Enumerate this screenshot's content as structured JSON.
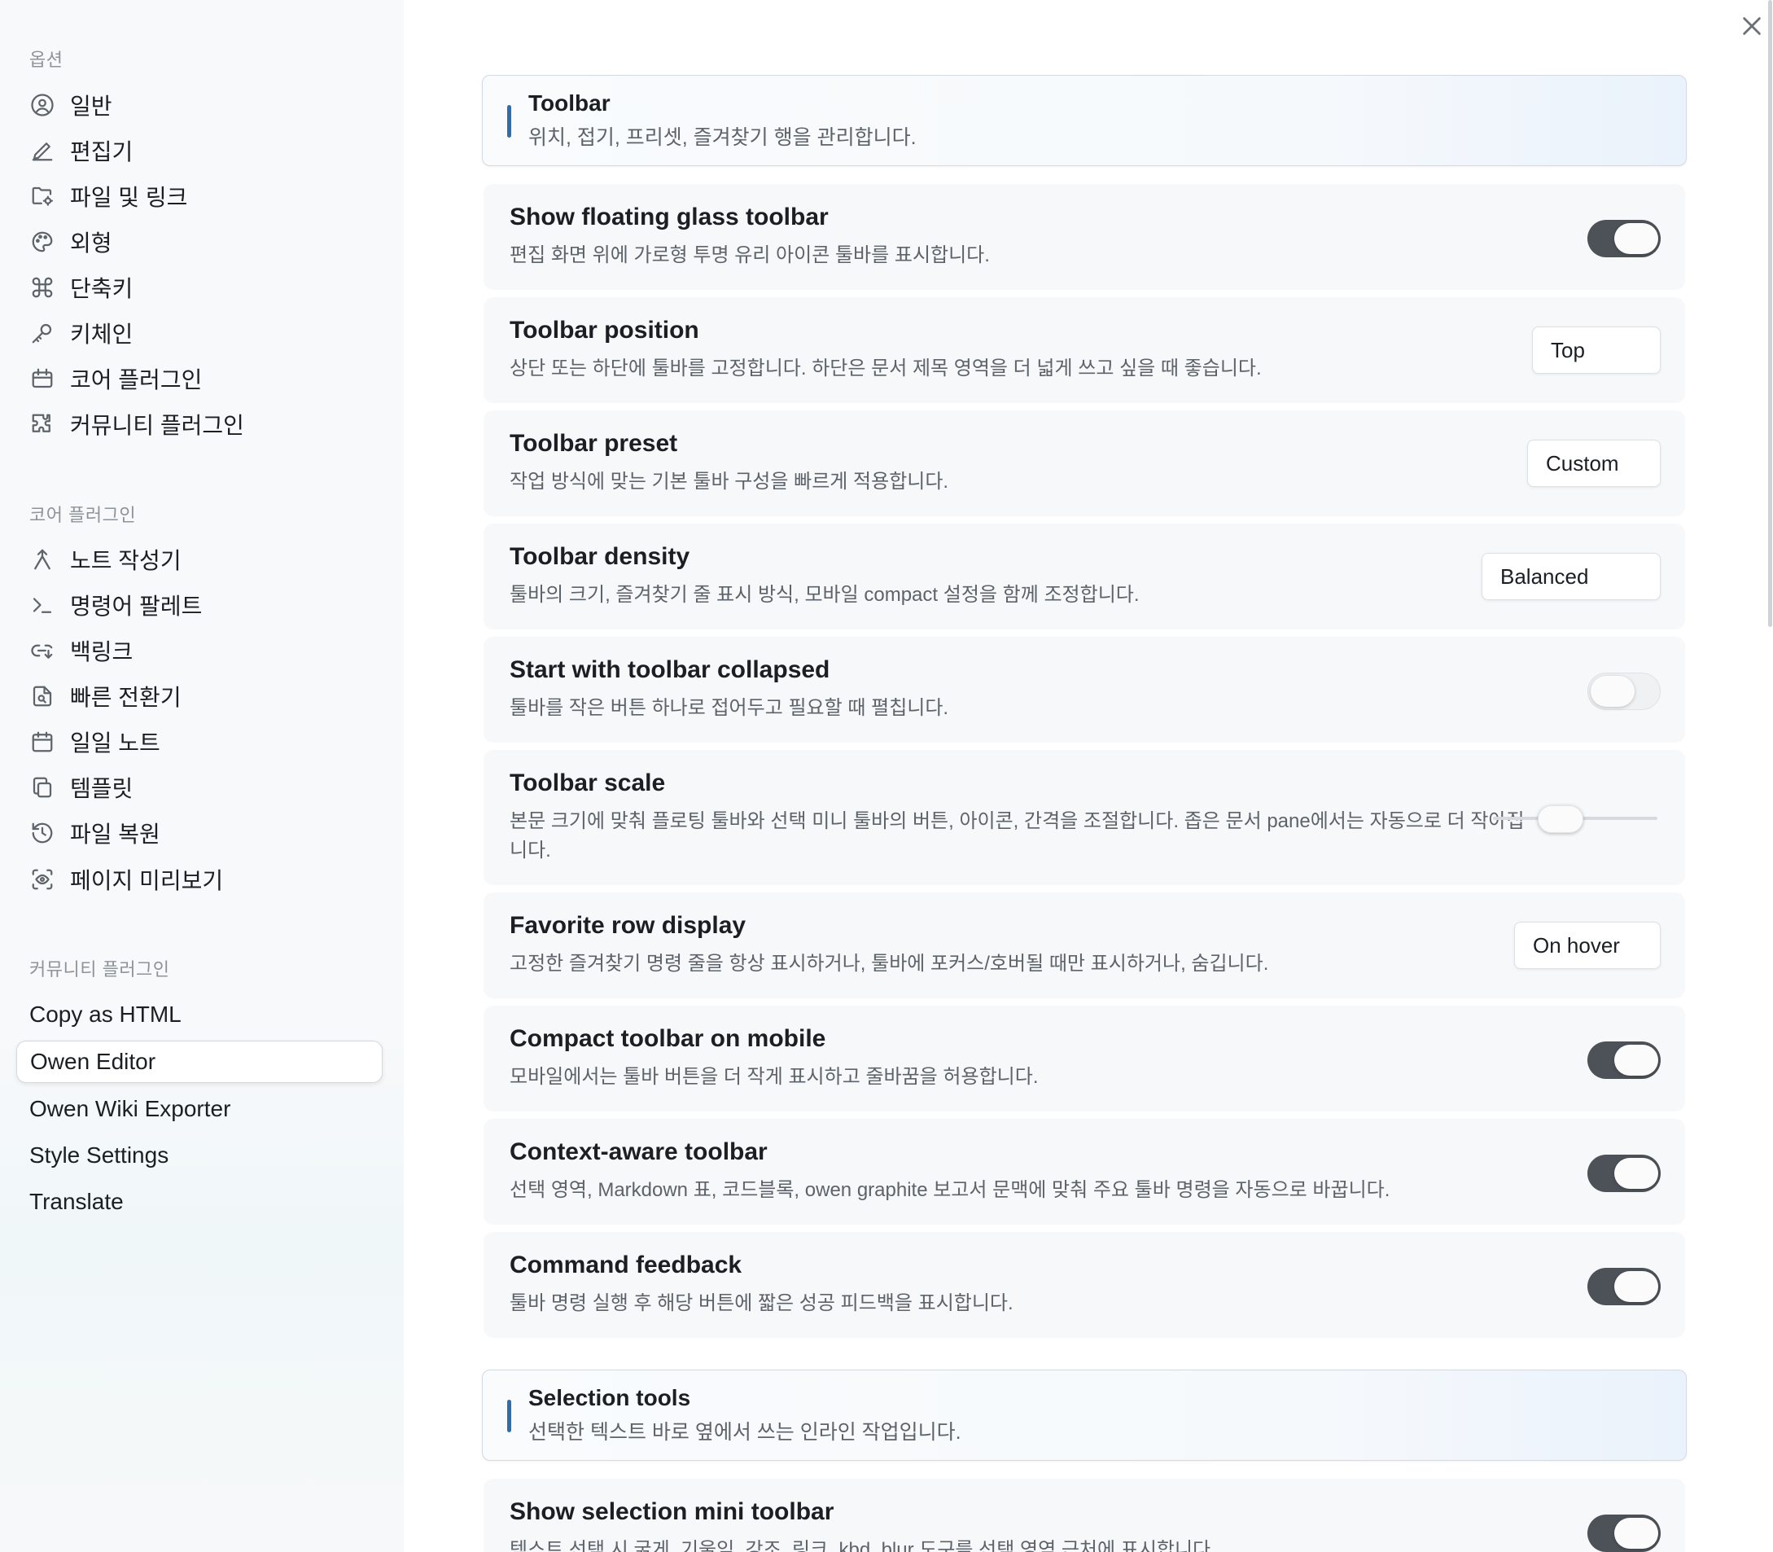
{
  "sidebar": {
    "options_heading": "옵션",
    "options_items": [
      {
        "label": "일반",
        "icon": "user-circle-icon"
      },
      {
        "label": "편집기",
        "icon": "pencil-icon"
      },
      {
        "label": "파일 및 링크",
        "icon": "folder-cog-icon"
      },
      {
        "label": "외형",
        "icon": "palette-icon"
      },
      {
        "label": "단축키",
        "icon": "command-icon"
      },
      {
        "label": "키체인",
        "icon": "key-icon"
      },
      {
        "label": "코어 플러그인",
        "icon": "calendar-box-icon"
      },
      {
        "label": "커뮤니티 플러그인",
        "icon": "puzzle-icon"
      }
    ],
    "core_heading": "코어 플러그인",
    "core_items": [
      {
        "label": "노트 작성기",
        "icon": "merge-arrow-icon"
      },
      {
        "label": "명령어 팔레트",
        "icon": "terminal-icon"
      },
      {
        "label": "백링크",
        "icon": "link-back-icon"
      },
      {
        "label": "빠른 전환기",
        "icon": "file-search-icon"
      },
      {
        "label": "일일 노트",
        "icon": "calendar-icon"
      },
      {
        "label": "템플릿",
        "icon": "copy-icon"
      },
      {
        "label": "파일 복원",
        "icon": "history-icon"
      },
      {
        "label": "페이지 미리보기",
        "icon": "scan-eye-icon"
      }
    ],
    "community_heading": "커뮤니티 플러그인",
    "community_items": [
      {
        "label": "Copy as HTML",
        "active": false
      },
      {
        "label": "Owen Editor",
        "active": true
      },
      {
        "label": "Owen Wiki Exporter",
        "active": false
      },
      {
        "label": "Style Settings",
        "active": false
      },
      {
        "label": "Translate",
        "active": false
      }
    ]
  },
  "main": {
    "close_icon": "close-icon",
    "toolbar_section": {
      "title": "Toolbar",
      "desc": "위치, 접기, 프리셋, 즐겨찾기 행을 관리합니다."
    },
    "rows": [
      {
        "title": "Show floating glass toolbar",
        "desc": "편집 화면 위에 가로형 투명 유리 아이콘 툴바를 표시합니다.",
        "control": "toggle",
        "on": true
      },
      {
        "title": "Toolbar position",
        "desc": "상단 또는 하단에 툴바를 고정합니다. 하단은 문서 제목 영역을 더 넓게 쓰고 싶을 때 좋습니다.",
        "control": "dropdown",
        "value": "Top"
      },
      {
        "title": "Toolbar preset",
        "desc": "작업 방식에 맞는 기본 툴바 구성을 빠르게 적용합니다.",
        "control": "dropdown",
        "value": "Custom"
      },
      {
        "title": "Toolbar density",
        "desc": "툴바의 크기, 즐겨찾기 줄 표시 방식, 모바일 compact 설정을 함께 조정합니다.",
        "control": "dropdown",
        "value": "Balanced"
      },
      {
        "title": "Start with toolbar collapsed",
        "desc": "툴바를 작은 버튼 하나로 접어두고 필요할 때 펼칩니다.",
        "control": "toggle",
        "on": false
      },
      {
        "title": "Toolbar scale",
        "desc": "본문 크기에 맞춰 플로팅 툴바와 선택 미니 툴바의 버튼, 아이콘, 간격을 조절합니다. 좁은 문서 pane에서는 자동으로 더 작아집니다.",
        "control": "slider",
        "value_fraction": 0.38
      },
      {
        "title": "Favorite row display",
        "desc": "고정한 즐겨찾기 명령 줄을 항상 표시하거나, 툴바에 포커스/호버될 때만 표시하거나, 숨깁니다.",
        "control": "dropdown",
        "value": "On hover"
      },
      {
        "title": "Compact toolbar on mobile",
        "desc": "모바일에서는 툴바 버튼을 더 작게 표시하고 줄바꿈을 허용합니다.",
        "control": "toggle",
        "on": true
      },
      {
        "title": "Context-aware toolbar",
        "desc": "선택 영역, Markdown 표, 코드블록, owen graphite 보고서 문맥에 맞춰 주요 툴바 명령을 자동으로 바꿉니다.",
        "control": "toggle",
        "on": true
      },
      {
        "title": "Command feedback",
        "desc": "툴바 명령 실행 후 해당 버튼에 짧은 성공 피드백을 표시합니다.",
        "control": "toggle",
        "on": true
      }
    ],
    "selection_section": {
      "title": "Selection tools",
      "desc": "선택한 텍스트 바로 옆에서 쓰는 인라인 작업입니다."
    },
    "selection_rows": [
      {
        "title": "Show selection mini toolbar",
        "desc": "텍스트 선택 시 굵게, 기울임, 강조, 링크, kbd, blur 도구를 선택 영역 근처에 표시합니다.",
        "control": "toggle",
        "on": true
      }
    ]
  }
}
